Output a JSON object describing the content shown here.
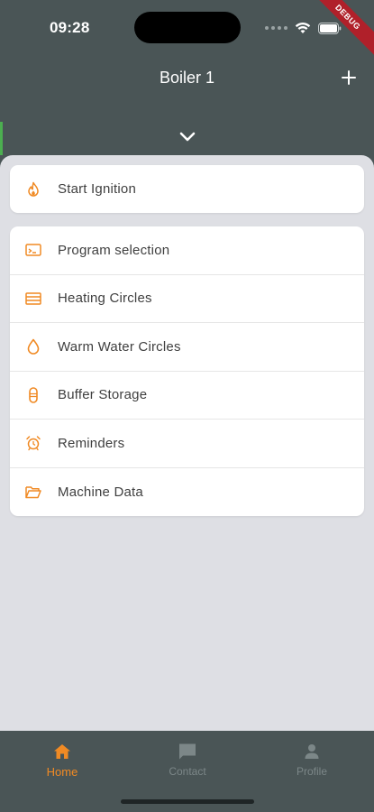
{
  "status_bar": {
    "time": "09:28",
    "debug_banner": "DEBUG",
    "icons": [
      "signal-icon",
      "wifi-icon",
      "battery-icon"
    ]
  },
  "app_bar": {
    "title": "Boiler 1",
    "add_icon": "plus-icon",
    "collapse_icon": "chevron-down-icon"
  },
  "ignition": {
    "label": "Start Ignition",
    "icon": "flame-icon"
  },
  "menu": {
    "items": [
      {
        "label": "Program selection",
        "icon": "program-window-icon"
      },
      {
        "label": "Heating Circles",
        "icon": "radiator-icon"
      },
      {
        "label": "Warm Water Circles",
        "icon": "water-drop-icon"
      },
      {
        "label": "Buffer Storage",
        "icon": "storage-tank-icon"
      },
      {
        "label": "Reminders",
        "icon": "alarm-clock-icon"
      },
      {
        "label": "Machine Data",
        "icon": "folder-open-icon"
      }
    ]
  },
  "bottom_nav": {
    "items": [
      {
        "label": "Home",
        "icon": "home-icon",
        "active": true
      },
      {
        "label": "Contact",
        "icon": "chat-icon",
        "active": false
      },
      {
        "label": "Profile",
        "icon": "person-icon",
        "active": false
      }
    ]
  },
  "colors": {
    "app_bar_bg": "#4a5556",
    "accent": "#f08a24",
    "sheet_bg": "#dedfe4",
    "card_bg": "#ffffff",
    "inactive_nav": "#7c8788",
    "debug_ribbon": "#b0202a",
    "green_accent": "#4caf50"
  }
}
